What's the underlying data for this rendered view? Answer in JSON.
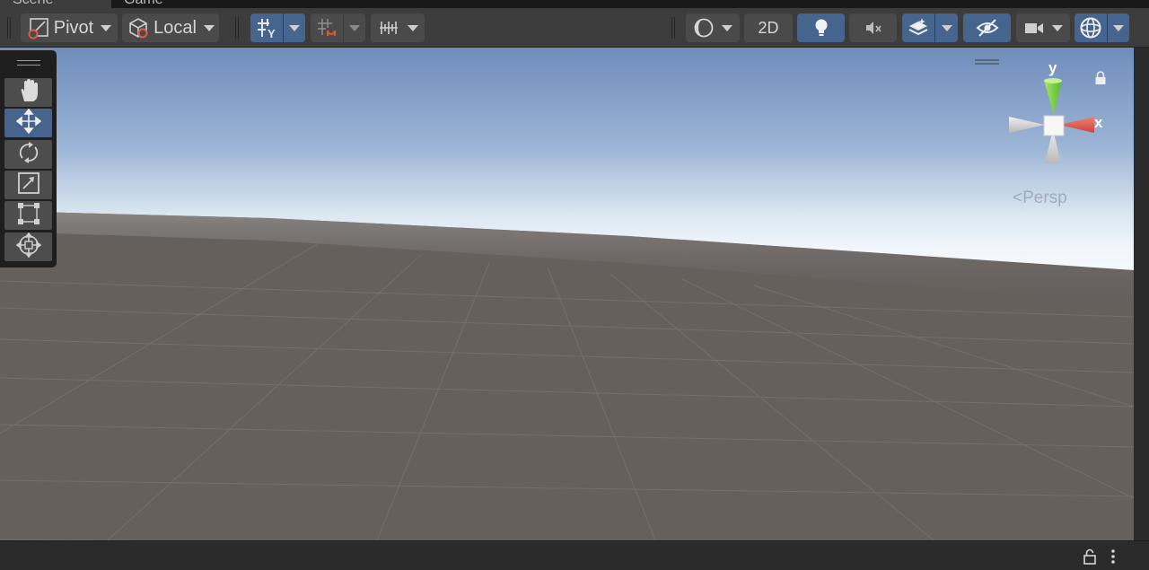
{
  "tabs": [
    {
      "label": "Scene",
      "active": true
    },
    {
      "label": "Game",
      "active": false
    }
  ],
  "toolbar": {
    "pivot_label": "Pivot",
    "local_label": "Local",
    "mode_2d_label": "2D"
  },
  "gizmo": {
    "y_label": "y",
    "x_label": "x",
    "projection_label": "Persp"
  },
  "colors": {
    "accent_blue": "#45658e",
    "toolbar_bg": "#3c3c3c",
    "ground": "#66605d",
    "sky_top": "#6f8cbb",
    "horizon": "#f1f6fb",
    "axis_x": "#e05a4e",
    "axis_y": "#7fd33b"
  },
  "icons": {
    "tools": [
      "hand-icon",
      "move-icon",
      "rotate-icon",
      "scale-icon",
      "rect-tool-icon",
      "transform-icon"
    ],
    "active_tool": "move-icon"
  }
}
